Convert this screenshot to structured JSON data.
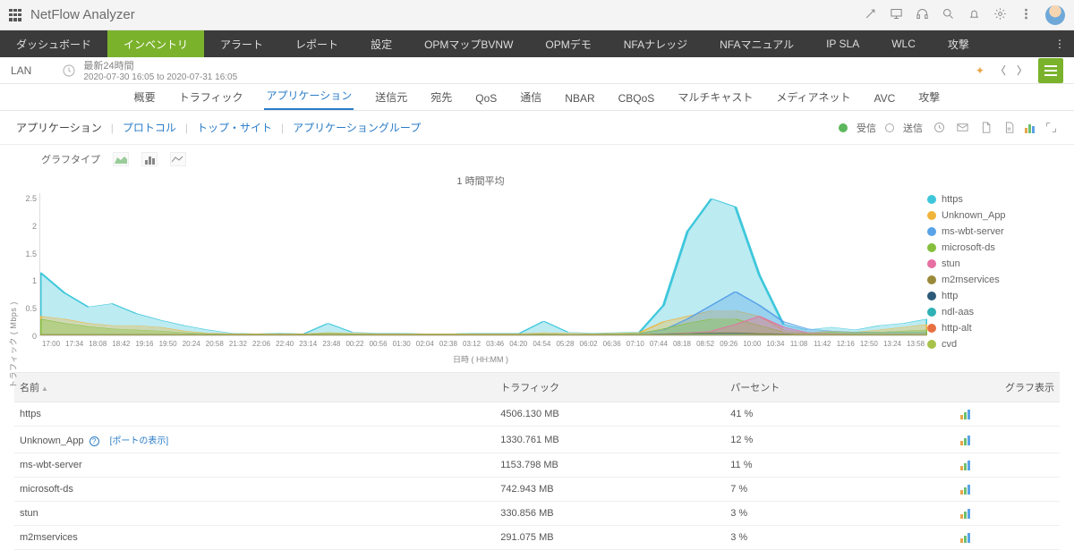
{
  "brand": "NetFlow Analyzer",
  "mainnav": [
    "ダッシュボード",
    "インベントリ",
    "アラート",
    "レポート",
    "設定",
    "OPMマップBVNW",
    "OPMデモ",
    "NFAナレッジ",
    "NFAマニュアル",
    "IP SLA",
    "WLC",
    "攻撃"
  ],
  "mainnav_active": 1,
  "subbar": {
    "device": "LAN",
    "range_label": "最新24時間",
    "range_text": "2020-07-30 16:05 to 2020-07-31 16:05"
  },
  "tabs2": [
    "概要",
    "トラフィック",
    "アプリケーション",
    "送信元",
    "宛先",
    "QoS",
    "通信",
    "NBAR",
    "CBQoS",
    "マルチキャスト",
    "メディアネット",
    "AVC",
    "攻撃"
  ],
  "tabs2_active": 2,
  "subtabs": [
    "アプリケーション",
    "プロトコル",
    "トップ・サイト",
    "アプリケーショングループ"
  ],
  "subtabs_active": 0,
  "dir_labels": {
    "in": "受信",
    "out": "送信"
  },
  "graph_type_label": "グラフタイプ",
  "chart_meta": {
    "title": "1 時間平均",
    "ylabel": "トラフィック ( Mbps )",
    "xlabel": "日時 ( HH:MM )"
  },
  "chart_data": {
    "type": "area",
    "yticks": [
      0,
      0.5,
      1,
      1.5,
      2,
      2.5
    ],
    "ylim": [
      0,
      2.6
    ],
    "x": [
      "17:00",
      "17:34",
      "18:08",
      "18:42",
      "19:16",
      "19:50",
      "20:24",
      "20:58",
      "21:32",
      "22:06",
      "22:40",
      "23:14",
      "23:48",
      "00:22",
      "00:56",
      "01:30",
      "02:04",
      "02:38",
      "03:12",
      "03:46",
      "04:20",
      "04:54",
      "05:28",
      "06:02",
      "06:36",
      "07:10",
      "07:44",
      "08:18",
      "08:52",
      "09:26",
      "10:00",
      "10:34",
      "11:08",
      "11:42",
      "12:16",
      "12:50",
      "13:24",
      "13:58"
    ],
    "series": [
      {
        "name": "https",
        "color": "#3ec7db",
        "values": [
          1.15,
          0.78,
          0.52,
          0.58,
          0.4,
          0.28,
          0.18,
          0.1,
          0.04,
          0.03,
          0.04,
          0.03,
          0.22,
          0.06,
          0.04,
          0.04,
          0.03,
          0.03,
          0.04,
          0.04,
          0.04,
          0.26,
          0.06,
          0.04,
          0.05,
          0.06,
          0.55,
          1.9,
          2.5,
          2.35,
          1.1,
          0.2,
          0.1,
          0.15,
          0.1,
          0.18,
          0.22,
          0.3
        ]
      },
      {
        "name": "Unknown_App",
        "color": "#f0b43a",
        "values": [
          0.35,
          0.3,
          0.22,
          0.18,
          0.18,
          0.15,
          0.08,
          0.04,
          0.03,
          0.03,
          0.03,
          0.03,
          0.05,
          0.04,
          0.03,
          0.03,
          0.03,
          0.03,
          0.03,
          0.03,
          0.03,
          0.05,
          0.04,
          0.03,
          0.04,
          0.05,
          0.25,
          0.35,
          0.45,
          0.45,
          0.35,
          0.1,
          0.05,
          0.08,
          0.06,
          0.1,
          0.15,
          0.2
        ]
      },
      {
        "name": "ms-wbt-server",
        "color": "#5aa3e8",
        "values": [
          0.02,
          0.02,
          0.02,
          0.02,
          0.02,
          0.02,
          0.02,
          0.02,
          0.02,
          0.02,
          0.02,
          0.02,
          0.02,
          0.02,
          0.02,
          0.02,
          0.02,
          0.02,
          0.02,
          0.02,
          0.02,
          0.02,
          0.02,
          0.02,
          0.02,
          0.03,
          0.1,
          0.3,
          0.55,
          0.8,
          0.55,
          0.25,
          0.12,
          0.08,
          0.06,
          0.06,
          0.06,
          0.06
        ]
      },
      {
        "name": "microsoft-ds",
        "color": "#86bf3c",
        "values": [
          0.3,
          0.22,
          0.16,
          0.12,
          0.1,
          0.08,
          0.05,
          0.03,
          0.02,
          0.02,
          0.02,
          0.02,
          0.04,
          0.03,
          0.02,
          0.02,
          0.02,
          0.02,
          0.02,
          0.02,
          0.02,
          0.03,
          0.02,
          0.02,
          0.03,
          0.04,
          0.12,
          0.22,
          0.3,
          0.3,
          0.18,
          0.06,
          0.04,
          0.06,
          0.05,
          0.06,
          0.08,
          0.1
        ]
      },
      {
        "name": "stun",
        "color": "#e66fa3",
        "values": [
          0.01,
          0.01,
          0.01,
          0.01,
          0.01,
          0.01,
          0.01,
          0.01,
          0.01,
          0.01,
          0.01,
          0.01,
          0.01,
          0.01,
          0.01,
          0.01,
          0.01,
          0.01,
          0.01,
          0.01,
          0.01,
          0.01,
          0.01,
          0.01,
          0.01,
          0.01,
          0.03,
          0.05,
          0.08,
          0.2,
          0.35,
          0.15,
          0.05,
          0.03,
          0.02,
          0.02,
          0.02,
          0.02
        ]
      },
      {
        "name": "m2mservices",
        "color": "#9a8a3a",
        "values": [
          0.02,
          0.02,
          0.02,
          0.02,
          0.02,
          0.02,
          0.02,
          0.02,
          0.02,
          0.02,
          0.02,
          0.02,
          0.02,
          0.02,
          0.02,
          0.02,
          0.02,
          0.02,
          0.02,
          0.02,
          0.02,
          0.02,
          0.02,
          0.02,
          0.02,
          0.02,
          0.03,
          0.04,
          0.05,
          0.05,
          0.04,
          0.03,
          0.02,
          0.02,
          0.02,
          0.02,
          0.02,
          0.02
        ]
      },
      {
        "name": "http",
        "color": "#2c5a78",
        "values": [
          0.01,
          0.01,
          0.01,
          0.01,
          0.01,
          0.01,
          0.01,
          0.01,
          0.01,
          0.01,
          0.01,
          0.01,
          0.01,
          0.01,
          0.01,
          0.01,
          0.01,
          0.01,
          0.01,
          0.01,
          0.01,
          0.01,
          0.01,
          0.01,
          0.01,
          0.01,
          0.02,
          0.03,
          0.04,
          0.04,
          0.03,
          0.02,
          0.01,
          0.01,
          0.01,
          0.01,
          0.01,
          0.01
        ]
      },
      {
        "name": "ndl-aas",
        "color": "#2fb1b5",
        "values": [
          0.01,
          0.01,
          0.01,
          0.01,
          0.01,
          0.01,
          0.01,
          0.01,
          0.01,
          0.01,
          0.01,
          0.01,
          0.01,
          0.01,
          0.01,
          0.01,
          0.01,
          0.01,
          0.01,
          0.01,
          0.01,
          0.01,
          0.01,
          0.01,
          0.01,
          0.01,
          0.02,
          0.03,
          0.03,
          0.03,
          0.02,
          0.01,
          0.01,
          0.01,
          0.01,
          0.01,
          0.01,
          0.01
        ]
      },
      {
        "name": "http-alt",
        "color": "#e86f42",
        "values": [
          0.01,
          0.01,
          0.01,
          0.01,
          0.01,
          0.01,
          0.01,
          0.01,
          0.01,
          0.01,
          0.01,
          0.01,
          0.01,
          0.01,
          0.01,
          0.01,
          0.01,
          0.01,
          0.01,
          0.01,
          0.01,
          0.01,
          0.01,
          0.01,
          0.01,
          0.01,
          0.01,
          0.02,
          0.02,
          0.02,
          0.02,
          0.01,
          0.01,
          0.01,
          0.01,
          0.01,
          0.01,
          0.01
        ]
      },
      {
        "name": "cvd",
        "color": "#a6c24a",
        "values": [
          0.01,
          0.01,
          0.01,
          0.01,
          0.01,
          0.01,
          0.01,
          0.01,
          0.01,
          0.01,
          0.01,
          0.01,
          0.01,
          0.01,
          0.01,
          0.01,
          0.01,
          0.01,
          0.01,
          0.01,
          0.01,
          0.01,
          0.01,
          0.01,
          0.01,
          0.01,
          0.01,
          0.02,
          0.02,
          0.02,
          0.02,
          0.01,
          0.01,
          0.01,
          0.01,
          0.01,
          0.01,
          0.01
        ]
      }
    ]
  },
  "table": {
    "headers": [
      "名前",
      "トラフィック",
      "パーセント",
      "グラフ表示"
    ],
    "port_link_label": "[ポートの表示]",
    "rows": [
      {
        "name": "https",
        "traffic": "4506.130 MB",
        "percent": "41 %"
      },
      {
        "name": "Unknown_App",
        "traffic": "1330.761 MB",
        "percent": "12 %",
        "show_port": true
      },
      {
        "name": "ms-wbt-server",
        "traffic": "1153.798 MB",
        "percent": "11 %"
      },
      {
        "name": "microsoft-ds",
        "traffic": "742.943 MB",
        "percent": "7 %"
      },
      {
        "name": "stun",
        "traffic": "330.856 MB",
        "percent": "3 %"
      },
      {
        "name": "m2mservices",
        "traffic": "291.075 MB",
        "percent": "3 %"
      }
    ]
  }
}
